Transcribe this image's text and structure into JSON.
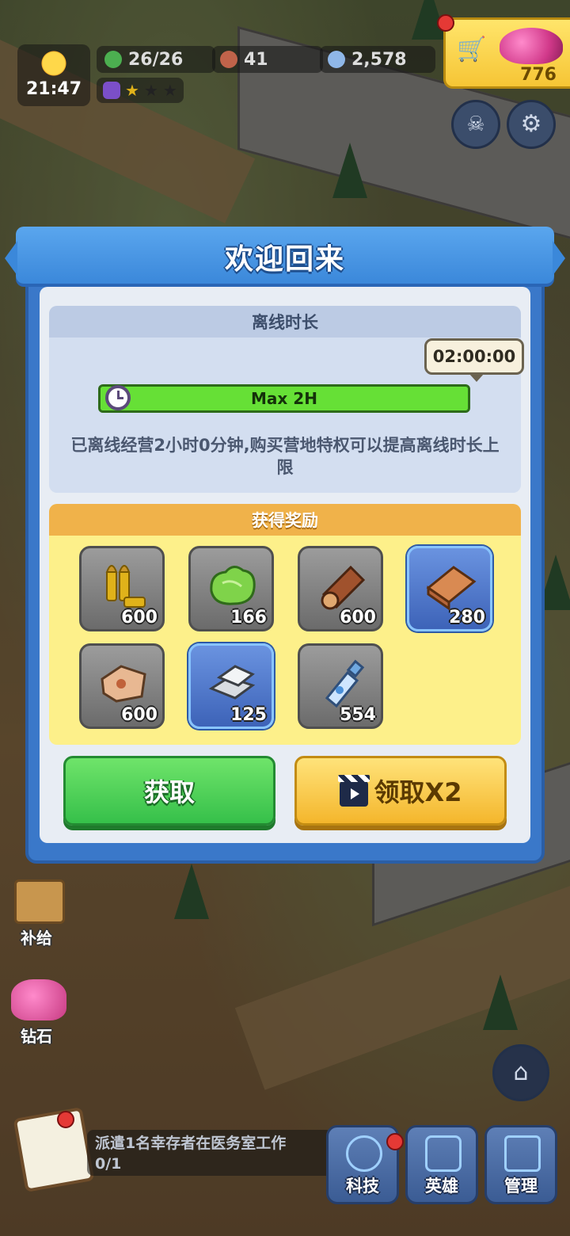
{
  "hud": {
    "clock_time": "21:47",
    "survivors": "26/26",
    "food": "41",
    "water": "2,578",
    "gems": "776"
  },
  "dialog": {
    "title": "欢迎回来",
    "offline_header": "离线时长",
    "offline_time": "02:00:00",
    "progress_label": "Max 2H",
    "progress_fraction": 1.0,
    "description": "已离线经营2小时0分钟,购买营地特权可以提高离线时长上限",
    "reward_header": "获得奖励",
    "rewards": [
      {
        "icon": "bullets-icon",
        "count": "600",
        "rarity": "common"
      },
      {
        "icon": "lettuce-icon",
        "count": "166",
        "rarity": "common"
      },
      {
        "icon": "log-icon",
        "count": "600",
        "rarity": "common"
      },
      {
        "icon": "planks-icon",
        "count": "280",
        "rarity": "rare"
      },
      {
        "icon": "leather-icon",
        "count": "600",
        "rarity": "common"
      },
      {
        "icon": "iron-ingot-icon",
        "count": "125",
        "rarity": "rare"
      },
      {
        "icon": "water-bottle-icon",
        "count": "554",
        "rarity": "common"
      }
    ],
    "claim_label": "获取",
    "claim_x2_label": "领取X2"
  },
  "side": {
    "supply_label": "补给",
    "diamond_label": "钻石"
  },
  "task": {
    "text": "派遣1名幸存者在医务室工作",
    "progress": "0/1"
  },
  "nav": {
    "tech": "科技",
    "heroes": "英雄",
    "manage": "管理"
  },
  "colors": {
    "dialog_blue": "#3a78c9",
    "progress_green": "#66e036",
    "claim_green": "#36c04a",
    "claim_x2_yellow": "#f4b62c"
  }
}
